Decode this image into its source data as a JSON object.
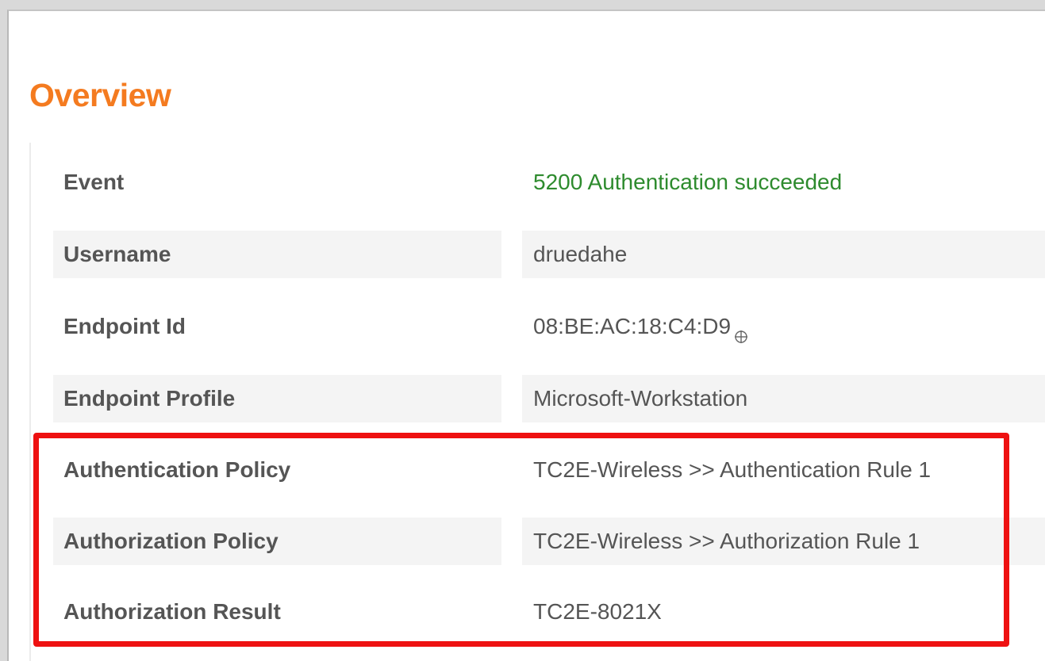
{
  "panel": {
    "title": "Overview"
  },
  "rows": [
    {
      "label": "Event",
      "value": "5200 Authentication succeeded",
      "status": "success"
    },
    {
      "label": "Username",
      "value": "druedahe"
    },
    {
      "label": "Endpoint Id",
      "value": "08:BE:AC:18:C4:D9",
      "icon": "crosshair-icon"
    },
    {
      "label": "Endpoint Profile",
      "value": "Microsoft-Workstation"
    },
    {
      "label": "Authentication Policy",
      "value": "TC2E-Wireless >> Authentication Rule 1"
    },
    {
      "label": "Authorization Policy",
      "value": "TC2E-Wireless >> Authorization Rule 1"
    },
    {
      "label": "Authorization Result",
      "value": "TC2E-8021X"
    }
  ],
  "colors": {
    "title": "#f47b20",
    "success_text": "#2e8b2e",
    "highlight_border": "#ee1111",
    "row_shade": "#f4f4f4"
  }
}
